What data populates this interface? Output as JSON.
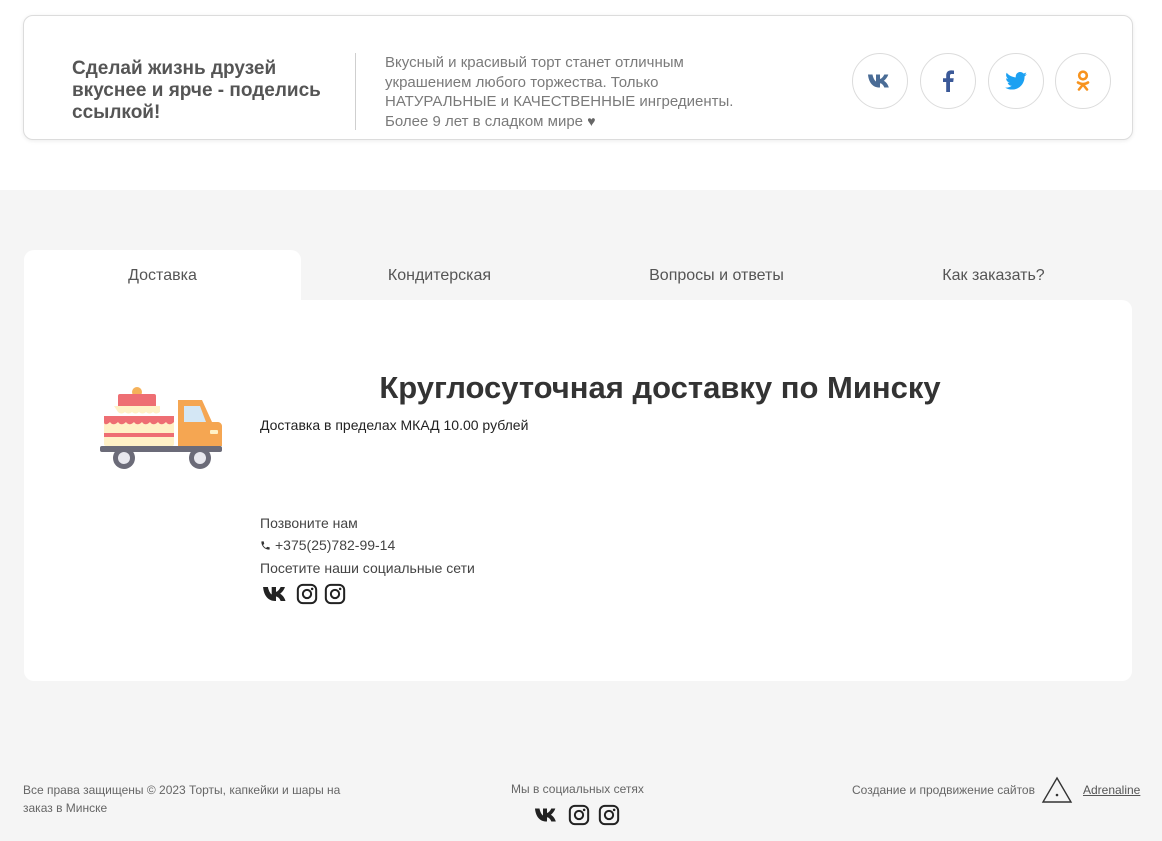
{
  "share": {
    "title": "Сделай жизнь друзей вкуснее и ярче - поделись ссылкой!",
    "description": "Вкусный и красивый торт станет отличным украшением любого торжества. Только НАТУРАЛЬНЫЕ и КАЧЕСТВЕННЫЕ ингредиенты. Более 9 лет в сладком мире",
    "heart": "♥",
    "buttons": [
      {
        "icon": "vk-icon",
        "color": "#4a76a8"
      },
      {
        "icon": "facebook-icon",
        "color": "#3b5998"
      },
      {
        "icon": "twitter-icon",
        "color": "#1da1f2"
      },
      {
        "icon": "odnoklassniki-icon",
        "color": "#f7931e"
      }
    ]
  },
  "tabs": [
    {
      "label": "Доставка",
      "active": true
    },
    {
      "label": "Кондитерская",
      "active": false
    },
    {
      "label": "Вопросы и ответы",
      "active": false
    },
    {
      "label": "Как заказать?",
      "active": false
    }
  ],
  "delivery": {
    "title": "Круглосуточная доставку по Минску",
    "subtitle": "Доставка в пределах МКАД 10.00 рублей",
    "call_label": "Позвоните нам",
    "phone": "+375(25)782-99-14",
    "social_label": "Посетите наши социальные сети",
    "social_icons": [
      "vk-icon",
      "instagram-icon",
      "instagram-icon"
    ]
  },
  "footer": {
    "copyright": "Все права защищены © 2023 Торты, капкейки и шары на заказ в Минске",
    "social_label": "Мы в социальных сетях",
    "social_icons": [
      "vk-icon",
      "instagram-icon",
      "instagram-icon"
    ],
    "creator_label": "Создание и продвижение сайтов",
    "creator_link": "Adrenaline"
  }
}
